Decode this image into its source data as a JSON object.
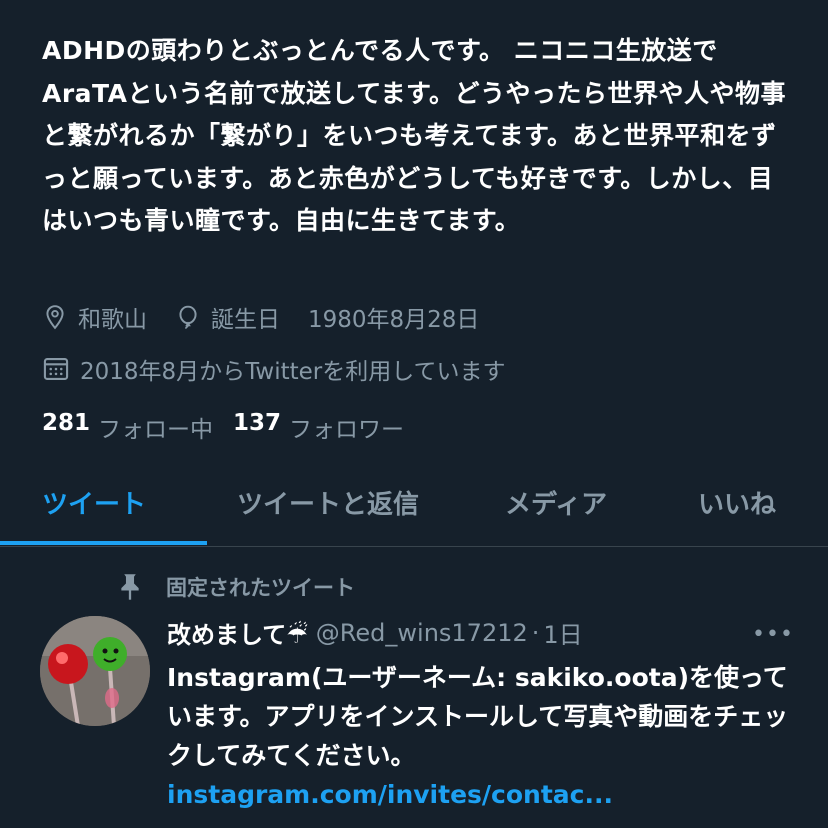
{
  "profile": {
    "bio": "ADHDの頭わりとぶっとんでる人です。 ニコニコ生放送でAraTAという名前で放送してます。どうやったら世界や人や物事と繋がれるか「繋がり」をいつも考えてます。あと世界平和をずっと願っています。あと赤色がどうしても好きです。しかし、目はいつも青い瞳です。自由に生きてます。",
    "location": "和歌山",
    "birthday_label": "誕生日",
    "birthday": "1980年8月28日",
    "joined": "2018年8月からTwitterを利用しています",
    "following_count": "281",
    "following_label": "フォロー中",
    "followers_count": "137",
    "followers_label": "フォロワー"
  },
  "tabs": [
    {
      "label": "ツイート",
      "active": true
    },
    {
      "label": "ツイートと返信",
      "active": false
    },
    {
      "label": "メディア",
      "active": false
    },
    {
      "label": "いいね",
      "active": false
    }
  ],
  "pinned_tweet": {
    "pinned_label": "固定されたツイート",
    "display_name": "改めまして☔",
    "handle": "@Red_wins17212",
    "separator": "·",
    "time": "1日",
    "more": "•••",
    "text": "Instagram(ユーザーネーム: sakiko.oota)を使っています。アプリをインストールして写真や動画をチェックしてみてください。",
    "link": "instagram.com/invites/contac..."
  },
  "colors": {
    "background": "#15202b",
    "accent": "#1da1f2",
    "secondary_text": "#8899a6"
  },
  "icons": {
    "location": "location-pin-icon",
    "birthday": "balloon-icon",
    "joined": "calendar-icon",
    "pinned": "pin-icon",
    "more": "more-icon"
  }
}
